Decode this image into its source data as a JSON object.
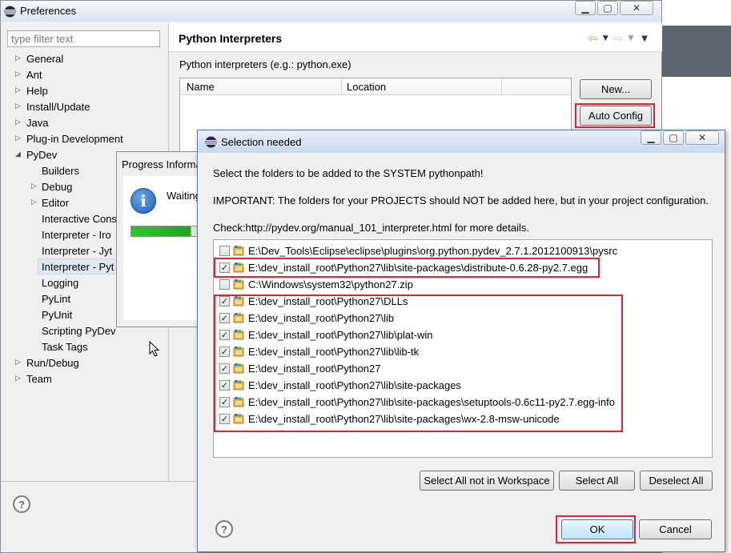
{
  "preferences": {
    "title": "Preferences",
    "filter_placeholder": "type filter text",
    "tree": [
      {
        "label": "General",
        "arrow": "▷"
      },
      {
        "label": "Ant",
        "arrow": "▷"
      },
      {
        "label": "Help",
        "arrow": "▷"
      },
      {
        "label": "Install/Update",
        "arrow": "▷"
      },
      {
        "label": "Java",
        "arrow": "▷"
      },
      {
        "label": "Plug-in Development",
        "arrow": "▷"
      },
      {
        "label": "PyDev",
        "arrow": "◢"
      },
      {
        "label": "Builders",
        "arrow": ""
      },
      {
        "label": "Debug",
        "arrow": "▷"
      },
      {
        "label": "Editor",
        "arrow": "▷"
      },
      {
        "label": "Interactive Cons",
        "arrow": ""
      },
      {
        "label": "Interpreter - Iro",
        "arrow": ""
      },
      {
        "label": "Interpreter - Jyt",
        "arrow": ""
      },
      {
        "label": "Interpreter - Pyt",
        "arrow": ""
      },
      {
        "label": "Logging",
        "arrow": ""
      },
      {
        "label": "PyLint",
        "arrow": ""
      },
      {
        "label": "PyUnit",
        "arrow": ""
      },
      {
        "label": "Scripting PyDev",
        "arrow": ""
      },
      {
        "label": "Task Tags",
        "arrow": ""
      },
      {
        "label": "Run/Debug",
        "arrow": "▷"
      },
      {
        "label": "Team",
        "arrow": "▷"
      }
    ],
    "page_title": "Python Interpreters",
    "interpreters_label": "Python interpreters (e.g.: python.exe)",
    "columns": [
      "Name",
      "Location"
    ],
    "new_button": "New...",
    "auto_config_button": "Auto Config",
    "help_glyph": "?"
  },
  "progress": {
    "title": "Progress Information",
    "message": "Waiting",
    "info_glyph": "i",
    "progress_fraction": 0.9
  },
  "selection": {
    "title": "Selection needed",
    "line1": "Select the folders to be added to the SYSTEM pythonpath!",
    "line2": "IMPORTANT: The folders for your PROJECTS should NOT be added here, but in your project configuration.",
    "line3": "Check:http://pydev.org/manual_101_interpreter.html for more details.",
    "items": [
      {
        "path": "E:\\Dev_Tools\\Eclipse\\eclipse\\plugins\\org.python.pydev_2.7.1.2012100913\\pysrc",
        "checked": false
      },
      {
        "path": "E:\\dev_install_root\\Python27\\lib\\site-packages\\distribute-0.6.28-py2.7.egg",
        "checked": true
      },
      {
        "path": "C:\\Windows\\system32\\python27.zip",
        "checked": false
      },
      {
        "path": "E:\\dev_install_root\\Python27\\DLLs",
        "checked": true
      },
      {
        "path": "E:\\dev_install_root\\Python27\\lib",
        "checked": true
      },
      {
        "path": "E:\\dev_install_root\\Python27\\lib\\plat-win",
        "checked": true
      },
      {
        "path": "E:\\dev_install_root\\Python27\\lib\\lib-tk",
        "checked": true
      },
      {
        "path": "E:\\dev_install_root\\Python27",
        "checked": true
      },
      {
        "path": "E:\\dev_install_root\\Python27\\lib\\site-packages",
        "checked": true
      },
      {
        "path": "E:\\dev_install_root\\Python27\\lib\\site-packages\\setuptools-0.6c11-py2.7.egg-info",
        "checked": true
      },
      {
        "path": "E:\\dev_install_root\\Python27\\lib\\site-packages\\wx-2.8-msw-unicode",
        "checked": true
      }
    ],
    "check_glyph": "✓",
    "select_not_in_workspace": "Select All not in Workspace",
    "select_all": "Select All",
    "deselect_all": "Deselect All",
    "ok": "OK",
    "cancel": "Cancel",
    "help_glyph": "?"
  },
  "colors": {
    "highlight": "#e0232e",
    "progress": "#22b022",
    "selection": "#dfe9f5"
  }
}
